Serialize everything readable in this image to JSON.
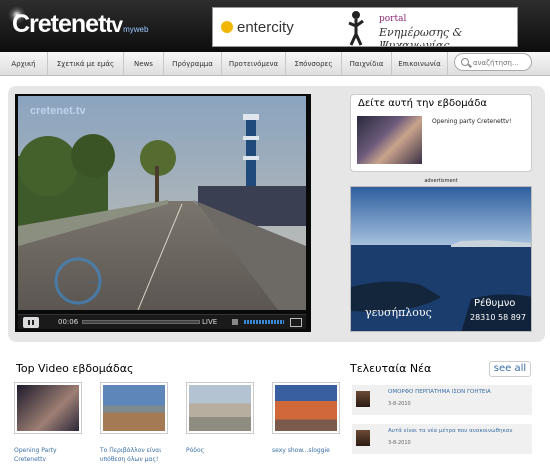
{
  "header": {
    "logo_main": "Cretenet",
    "logo_tv": "tv",
    "logo_sub": "myweb",
    "banner": {
      "brand": "entercity",
      "portal": "portal",
      "tagline": "Ενημέρωσης & Ψυχαγωγίας"
    }
  },
  "nav": {
    "items": [
      {
        "label": "Αρχική"
      },
      {
        "label": "Σχετικά με εμάς"
      },
      {
        "label": "News"
      },
      {
        "label": "Πρόγραμμα"
      },
      {
        "label": "Προτεινόμενα"
      },
      {
        "label": "Σπόνσορες"
      },
      {
        "label": "Παιχνίδια"
      },
      {
        "label": "Επικοινωνία"
      }
    ],
    "search_placeholder": "αναζήτηση..."
  },
  "player": {
    "watermark": "cretenet.tv",
    "time": "00:06",
    "live_label": "LIVE"
  },
  "watch": {
    "title": "Δείτε αυτή την εβδομάδα",
    "caption": "Opening party Cretenettv!"
  },
  "advert": {
    "label": "advertisment",
    "text_left": "γευσήπλους",
    "text_right": "Ρέθυμνο",
    "phone": "28310 58 897"
  },
  "top_videos": {
    "title": "Top Video εβδομάδας",
    "items": [
      {
        "caption_line1": "Opening Party",
        "caption_line2": "Cretenettv",
        "colors": [
          "#1d1b2c",
          "#9e7f74"
        ]
      },
      {
        "caption_line1": "Το Περιβάλλον είναι",
        "caption_line2": "υπόθεση όλων μας!",
        "colors": [
          "#5f86b8",
          "#a47a55"
        ]
      },
      {
        "caption_line1": "Ρόδος",
        "caption_line2": "",
        "colors": [
          "#b3c3d1",
          "#8f8d80"
        ]
      },
      {
        "caption_line1": "sexy show...sloggie",
        "caption_line2": "",
        "colors": [
          "#3a5fa0",
          "#d0683a"
        ]
      }
    ]
  },
  "news": {
    "title": "Τελευταία Νέα",
    "see_all": "see all",
    "items": [
      {
        "headline": "ΟΜΟΡΦΟ ΠΕΡΠΑΤΗΜΑ ΙΣΟΝ ΓΟΗΤΕΙΑ",
        "date": "3-8-2010"
      },
      {
        "headline": "Αυτά είναι τα νέα μέτρα που ανακοινώθηκαν",
        "date": "3-8-2010"
      }
    ]
  }
}
